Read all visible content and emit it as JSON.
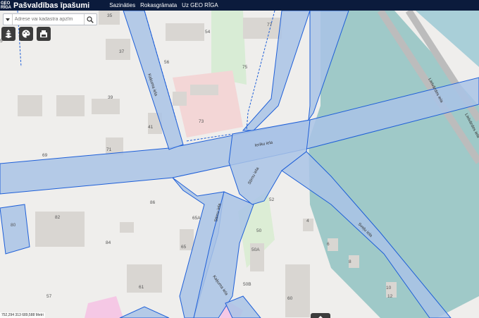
{
  "header": {
    "logo_line1": "GEO",
    "logo_line2": "RĪGA",
    "title": "Pašvaldības īpašumi",
    "nav": [
      "Sazināties",
      "Rokasgrāmata",
      "Uz GEO RĪGA"
    ]
  },
  "search": {
    "placeholder": "Adrese vai kadastra apzīm"
  },
  "tools": [
    "layers-tool-icon",
    "palette-tool-icon",
    "print-tool-icon"
  ],
  "map": {
    "streets": [
      "Ieriku iela",
      "Stirnu iela",
      "Stirnu iela",
      "Kaķuma iela",
      "Kaķuma iela",
      "Sveļu iela",
      "Lielvārdes iela",
      "Lielvārdes iela"
    ],
    "numbers": [
      "35",
      "54",
      "77",
      "37",
      "56",
      "75",
      "39",
      "73",
      "41",
      "71",
      "69",
      "86",
      "52",
      "80",
      "82",
      "65A",
      "4",
      "84",
      "65",
      "50",
      "6",
      "50A",
      "8",
      "57",
      "61",
      "50B",
      "10",
      "12",
      "60",
      "5"
    ]
  },
  "coords": "752,294 313 689,588 Metri",
  "colors": {
    "header": "#0b1b3c",
    "parcel_fill": "#a9c3e6",
    "parcel_stroke": "#1e5fd8",
    "water": "#9fc9c8"
  }
}
